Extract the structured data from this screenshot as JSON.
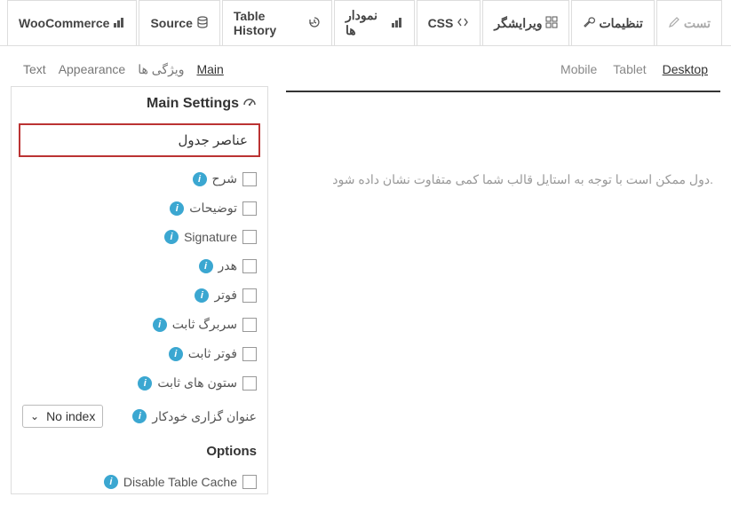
{
  "topTabs": [
    {
      "label": "WooCommerce",
      "icon": "chart"
    },
    {
      "label": "Source",
      "icon": "db"
    },
    {
      "label": "Table History",
      "icon": "history"
    },
    {
      "label": "نمودار ها",
      "icon": "chart"
    },
    {
      "label": "CSS",
      "icon": "code"
    },
    {
      "label": "ویرایشگر",
      "icon": "grid"
    },
    {
      "label": "تنظیمات",
      "icon": "wrench",
      "active": false
    },
    {
      "label": "تست",
      "icon": "pencil",
      "active": true
    }
  ],
  "subTabs": {
    "items": [
      "Text",
      "Appearance",
      "ویژگی ها",
      "Main"
    ],
    "active": 3
  },
  "panel": {
    "title": "Main Settings",
    "sectionHead": "عناصر جدول",
    "rows": [
      {
        "label": "شرح"
      },
      {
        "label": "توضیحات"
      },
      {
        "label": "Signature"
      },
      {
        "label": "هدر"
      },
      {
        "label": "فوتر"
      },
      {
        "label": "سربرگ ثابت"
      },
      {
        "label": "فوتر ثابت"
      },
      {
        "label": "ستون های ثابت"
      }
    ],
    "autoIndexLabel": "عنوان گزاری خودکار",
    "autoIndexSelect": "No index",
    "optionsTitle": "Options",
    "optionsRows": [
      {
        "label": "Disable Table Cache"
      }
    ]
  },
  "deviceTabs": {
    "items": [
      "Mobile",
      "Tablet",
      "Desktop"
    ],
    "active": 2
  },
  "previewNote": "دول ممکن است با توجه به استایل قالب شما کمی متفاوت نشان داده شود."
}
